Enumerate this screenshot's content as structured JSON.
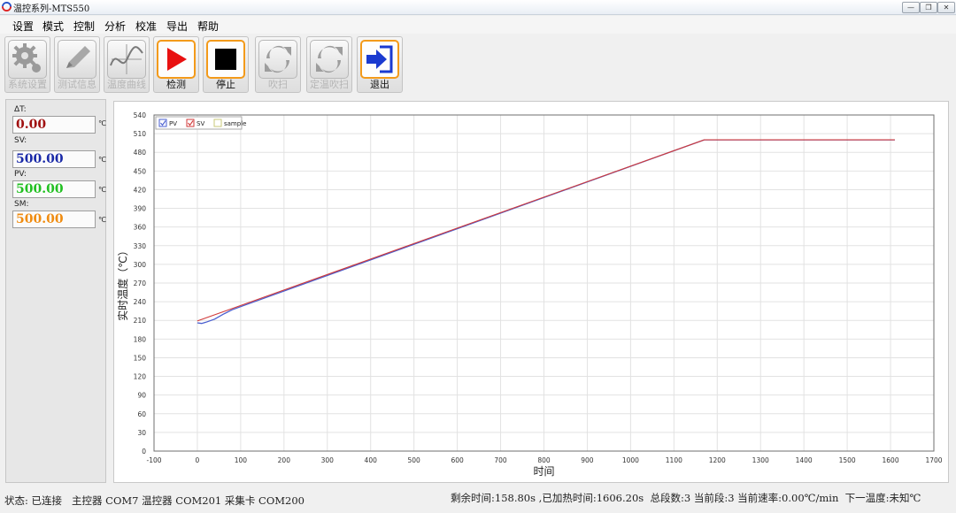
{
  "window": {
    "title": "温控系列-MTS550"
  },
  "menu": [
    "设置",
    "模式",
    "控制",
    "分析",
    "校准",
    "导出",
    "帮助"
  ],
  "toolbar": [
    {
      "label": "系统设置",
      "icon": "gear-icon",
      "enabled": false
    },
    {
      "label": "测试信息",
      "icon": "pencil-icon",
      "enabled": false
    },
    {
      "label": "温度曲线",
      "icon": "curve-chart-icon",
      "enabled": false
    },
    {
      "label": "检测",
      "icon": "play-icon",
      "enabled": true
    },
    {
      "label": "停止",
      "icon": "stop-icon",
      "enabled": true
    },
    {
      "label": "吹扫",
      "icon": "refresh-arrows-icon",
      "enabled": false
    },
    {
      "label": "定温吹扫",
      "icon": "refresh-arrows-icon",
      "enabled": false
    },
    {
      "label": "退出",
      "icon": "exit-arrow-icon",
      "enabled": true
    }
  ],
  "readouts": [
    {
      "label": "ΔT:",
      "value": "0.00",
      "unit": "℃",
      "color": "#a01010"
    },
    {
      "label": "SV:",
      "value": "500.00",
      "unit": "℃",
      "color": "#1a2aa8"
    },
    {
      "label": "PV:",
      "value": "500.00",
      "unit": "℃",
      "color": "#22c022"
    },
    {
      "label": "SM:",
      "value": "500.00",
      "unit": "℃",
      "color": "#f08c10"
    }
  ],
  "status": {
    "left": "状态: 已连接   主控器 COM7 温控器 COM201 采集卡 COM200",
    "right": "剩余时间:158.80s ,已加热时间:1606.20s  总段数:3 当前段:3 当前速率:0.00℃/min  下一温度:未知℃"
  },
  "chart_data": {
    "type": "line",
    "xlabel": "时间",
    "ylabel": "实时温度（℃）",
    "xlim": [
      -100,
      1700
    ],
    "ylim": [
      0,
      540
    ],
    "xticks": [
      -100,
      0,
      100,
      200,
      300,
      400,
      500,
      600,
      700,
      800,
      900,
      1000,
      1100,
      1200,
      1300,
      1400,
      1500,
      1600,
      1700
    ],
    "yticks": [
      0,
      30,
      60,
      90,
      120,
      150,
      180,
      210,
      240,
      270,
      300,
      330,
      360,
      390,
      420,
      450,
      480,
      510,
      540
    ],
    "grid": true,
    "legend_position": "top-left",
    "series": [
      {
        "name": "PV",
        "color": "#4a5fd0",
        "x": [
          0,
          10,
          20,
          40,
          60,
          80,
          100,
          1170,
          1610
        ],
        "y": [
          206,
          205,
          207,
          212,
          220,
          227,
          232,
          500,
          500
        ]
      },
      {
        "name": "SV",
        "color": "#d03a3a",
        "x": [
          0,
          1170,
          1610
        ],
        "y": [
          209,
          500,
          500
        ]
      },
      {
        "name": "sample",
        "color": "#c8c878",
        "x": [],
        "y": []
      }
    ]
  }
}
